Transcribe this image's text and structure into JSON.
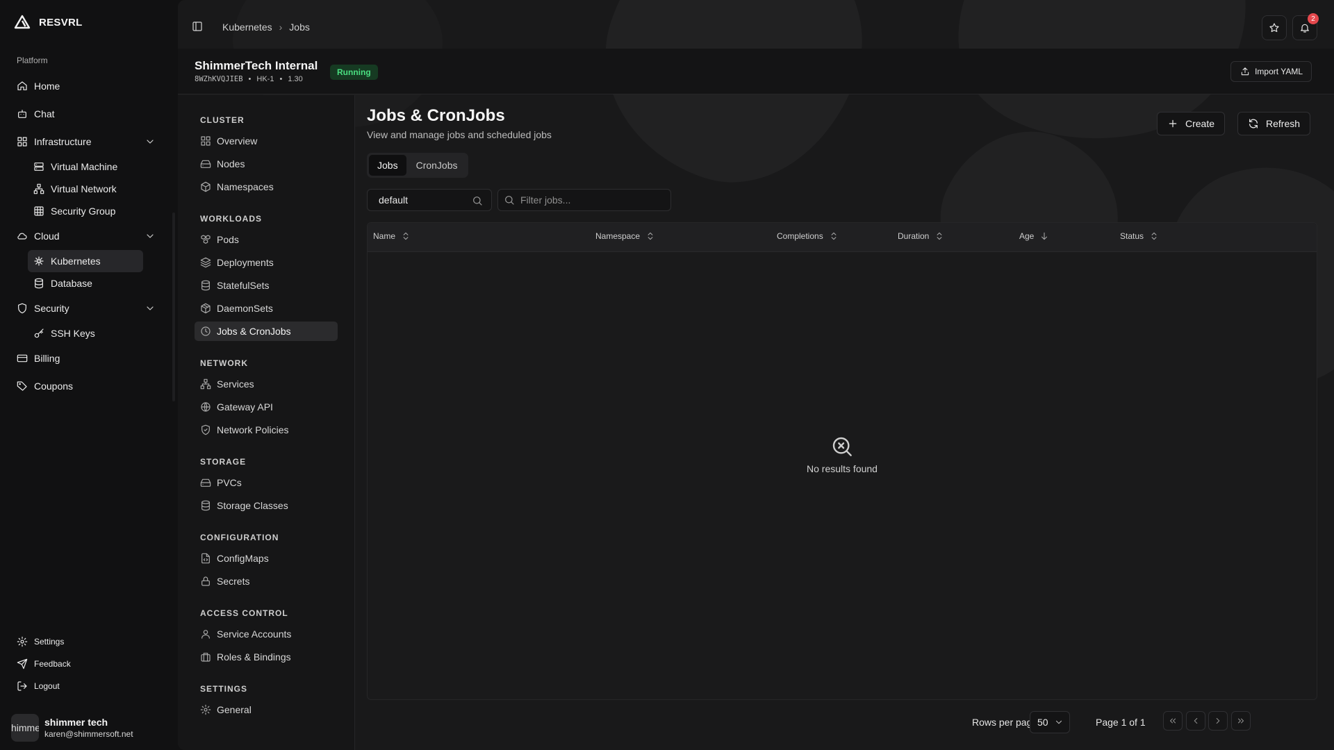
{
  "brand": {
    "name": "RESVRL"
  },
  "sidebar": {
    "group_label": "Platform",
    "items": [
      {
        "label": "Home",
        "icon": "home-icon"
      },
      {
        "label": "Chat",
        "icon": "chat-icon"
      },
      {
        "label": "Infrastructure",
        "icon": "grid-icon",
        "expanded": true,
        "children": [
          {
            "label": "Virtual Machine",
            "icon": "server-icon"
          },
          {
            "label": "Virtual Network",
            "icon": "network-icon"
          },
          {
            "label": "Security Group",
            "icon": "table-icon"
          }
        ]
      },
      {
        "label": "Cloud",
        "icon": "cloud-icon",
        "expanded": true,
        "children": [
          {
            "label": "Kubernetes",
            "icon": "helm-icon",
            "active": true
          },
          {
            "label": "Database",
            "icon": "database-icon"
          }
        ]
      },
      {
        "label": "Security",
        "icon": "shield-icon",
        "expanded": true,
        "children": [
          {
            "label": "SSH Keys",
            "icon": "key-icon"
          }
        ]
      },
      {
        "label": "Billing",
        "icon": "credit-card-icon"
      },
      {
        "label": "Coupons",
        "icon": "tag-icon"
      }
    ],
    "bottom": [
      {
        "label": "Settings",
        "icon": "gear-icon"
      },
      {
        "label": "Feedback",
        "icon": "send-icon"
      },
      {
        "label": "Logout",
        "icon": "logout-icon"
      }
    ],
    "user": {
      "avatar_text": "himme",
      "name": "shimmer tech",
      "email": "karen@shimmersoft.net"
    }
  },
  "header": {
    "breadcrumbs": [
      "Kubernetes",
      "Jobs"
    ],
    "breadcrumb_separator": "›",
    "notifications_count": "2"
  },
  "cluster": {
    "name": "ShimmerTech Internal",
    "id": "8WZhKVQJIEB",
    "region": "HK-1",
    "version": "1.30",
    "status": "Running",
    "status_color": "#4ade80",
    "import_label": "Import YAML"
  },
  "section_nav": {
    "groups": [
      {
        "title": "CLUSTER",
        "items": [
          {
            "label": "Overview",
            "icon": "layout-grid-icon"
          },
          {
            "label": "Nodes",
            "icon": "hard-drive-icon"
          },
          {
            "label": "Namespaces",
            "icon": "box-icon"
          }
        ]
      },
      {
        "title": "WORKLOADS",
        "items": [
          {
            "label": "Pods",
            "icon": "boxes-icon"
          },
          {
            "label": "Deployments",
            "icon": "layers-icon"
          },
          {
            "label": "StatefulSets",
            "icon": "database-icon"
          },
          {
            "label": "DaemonSets",
            "icon": "package-icon"
          },
          {
            "label": "Jobs & CronJobs",
            "icon": "clock-icon",
            "active": true
          }
        ]
      },
      {
        "title": "NETWORK",
        "items": [
          {
            "label": "Services",
            "icon": "network-icon"
          },
          {
            "label": "Gateway API",
            "icon": "globe-icon"
          },
          {
            "label": "Network Policies",
            "icon": "shield-check-icon"
          }
        ]
      },
      {
        "title": "STORAGE",
        "items": [
          {
            "label": "PVCs",
            "icon": "hard-drive-icon"
          },
          {
            "label": "Storage Classes",
            "icon": "database-icon"
          }
        ]
      },
      {
        "title": "CONFIGURATION",
        "items": [
          {
            "label": "ConfigMaps",
            "icon": "file-code-icon"
          },
          {
            "label": "Secrets",
            "icon": "lock-icon"
          }
        ]
      },
      {
        "title": "ACCESS CONTROL",
        "items": [
          {
            "label": "Service Accounts",
            "icon": "user-icon"
          },
          {
            "label": "Roles & Bindings",
            "icon": "briefcase-icon"
          }
        ]
      },
      {
        "title": "SETTINGS",
        "items": [
          {
            "label": "General",
            "icon": "gear-icon"
          }
        ]
      }
    ]
  },
  "content": {
    "title": "Jobs & CronJobs",
    "subtitle": "View and manage jobs and scheduled jobs",
    "create_label": "Create",
    "refresh_label": "Refresh",
    "tabs": [
      {
        "label": "Jobs",
        "active": true
      },
      {
        "label": "CronJobs"
      }
    ],
    "namespace_value": "default",
    "filter_placeholder": "Filter jobs...",
    "filter_value": "",
    "columns": [
      {
        "label": "Name",
        "sort": "unsorted"
      },
      {
        "label": "Namespace",
        "sort": "unsorted"
      },
      {
        "label": "Completions",
        "sort": "unsorted"
      },
      {
        "label": "Duration",
        "sort": "unsorted"
      },
      {
        "label": "Age",
        "sort": "desc"
      },
      {
        "label": "Status",
        "sort": "unsorted"
      }
    ],
    "rows": [],
    "empty_text": "No results found"
  },
  "pagination": {
    "rows_per_page_label": "Rows per page",
    "rows_per_page": "50",
    "page_info": "Page 1 of 1"
  }
}
